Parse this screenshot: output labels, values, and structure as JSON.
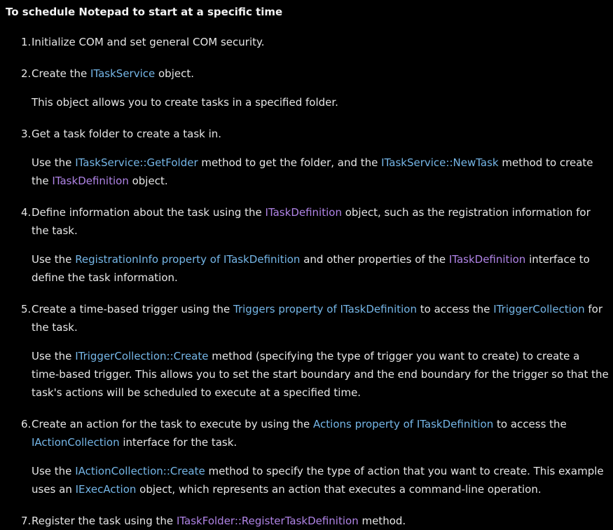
{
  "title": "To schedule Notepad to start at a specific time",
  "colors": {
    "background": "#000000",
    "text": "#e6e6e6",
    "link": "#75b6e7",
    "visited_link": "#b084e6"
  },
  "steps": [
    {
      "num": "1.",
      "t1": "Initialize COM and set general COM security."
    },
    {
      "num": "2.",
      "t1": "Create the ",
      "l1": "ITaskService",
      "t2": " object.",
      "note": {
        "t1": "This object allows you to create tasks in a specified folder."
      }
    },
    {
      "num": "3.",
      "t1": "Get a task folder to create a task in.",
      "note": {
        "t1": "Use the ",
        "l1": "ITaskService::GetFolder",
        "t2": " method to get the folder, and the ",
        "l2": "ITaskService::NewTask",
        "t3": " method to create the ",
        "l3": "ITaskDefinition",
        "t4": " object."
      }
    },
    {
      "num": "4.",
      "t1": "Define information about the task using the ",
      "l1": "ITaskDefinition",
      "t2": " object, such as the registration information for the task.",
      "note": {
        "t1": "Use the ",
        "l1": "RegistrationInfo property of ITaskDefinition",
        "t2": " and other properties of the ",
        "l2": "ITaskDefinition",
        "t3": " interface to define the task information."
      }
    },
    {
      "num": "5.",
      "t1": "Create a time-based trigger using the ",
      "l1": "Triggers property of ITaskDefinition",
      "t2": " to access the ",
      "l2": "ITriggerCollection",
      "t3": " for the task.",
      "note": {
        "t1": "Use the ",
        "l1": "ITriggerCollection::Create",
        "t2": " method (specifying the type of trigger you want to create) to create a time-based trigger. This allows you to set the start boundary and the end boundary for the trigger so that the task's actions will be scheduled to execute at a specified time."
      }
    },
    {
      "num": "6.",
      "t1": "Create an action for the task to execute by using the ",
      "l1": "Actions property of ITaskDefinition",
      "t2": " to access the ",
      "l2": "IActionCollection",
      "t3": " interface for the task.",
      "note": {
        "t1": "Use the ",
        "l1": "IActionCollection::Create",
        "t2": " method to specify the type of action that you want to create. This example uses an ",
        "l2": "IExecAction",
        "t3": " object, which represents an action that executes a command-line operation."
      }
    },
    {
      "num": "7.",
      "t1": "Register the task using the ",
      "l1": "ITaskFolder::RegisterTaskDefinition",
      "t2": " method."
    }
  ]
}
